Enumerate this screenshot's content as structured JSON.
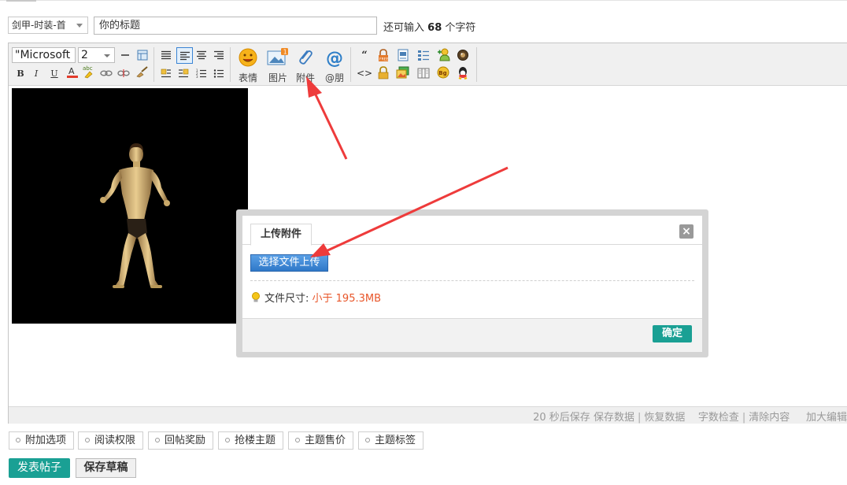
{
  "header": {
    "category_select": "剑甲-时装-首",
    "title_input": "你的标题",
    "remain_prefix": "还可输入",
    "remain_count": "68",
    "remain_suffix": "个字符"
  },
  "toolbar": {
    "font_name": "\"Microsoft",
    "font_size": "2",
    "emoji_label": "表情",
    "image_label": "图片",
    "attach_label": "附件",
    "mention_label": "@朋",
    "image_badge": "1"
  },
  "status": {
    "autosave": "20 秒后保存",
    "save_data": "保存数据",
    "restore_data": "恢复数据",
    "word_check": "字数检查",
    "clear_content": "清除内容",
    "enlarge": "加大编辑"
  },
  "options": [
    {
      "label": "附加选项"
    },
    {
      "label": "阅读权限"
    },
    {
      "label": "回帖奖励"
    },
    {
      "label": "抢楼主题"
    },
    {
      "label": "主题售价"
    },
    {
      "label": "主题标签"
    }
  ],
  "actions": {
    "publish": "发表帖子",
    "draft": "保存草稿"
  },
  "dialog": {
    "tab": "上传附件",
    "close": "×",
    "upload_button": "选择文件上传",
    "size_label": "文件尺寸:",
    "size_value": "小于 195.3MB",
    "ok": "确定"
  },
  "colors": {
    "accent": "#1aa094",
    "upload_blue": "#3a84d4",
    "size_value": "#e8562a",
    "annotation_arrow": "#ee3b3b"
  }
}
